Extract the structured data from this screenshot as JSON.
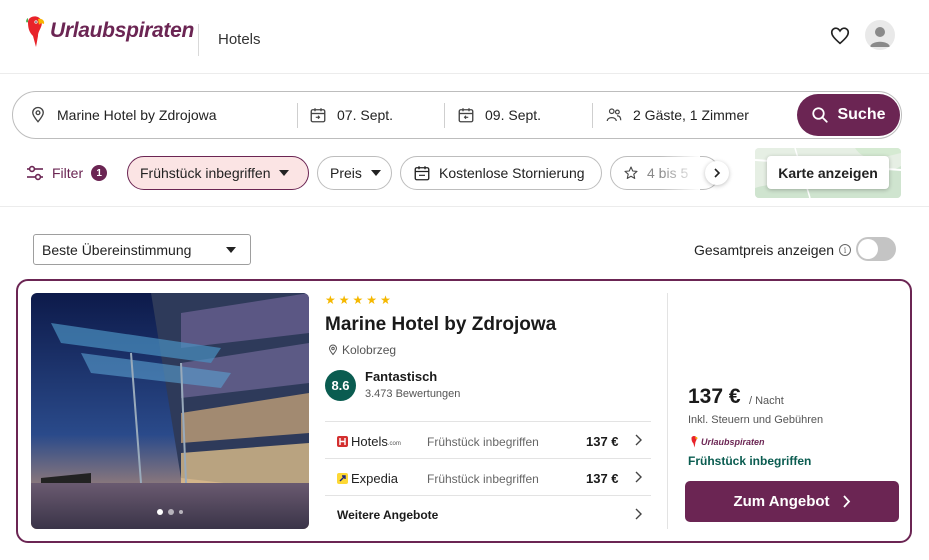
{
  "header": {
    "brand": "Urlaubspiraten",
    "section_label": "Hotels",
    "favorites_icon": "heart-icon",
    "profile_icon": "user-avatar-icon"
  },
  "search": {
    "destination": "Marine Hotel by Zdrojowa",
    "checkin": "07. Sept.",
    "checkout": "09. Sept.",
    "guests": "2 Gäste, 1 Zimmer",
    "button_label": "Suche"
  },
  "filters": {
    "filter_label": "Filter",
    "filter_count": "1",
    "chips": [
      {
        "label": "Frühstück inbegriffen",
        "active": true
      },
      {
        "label": "Preis",
        "active": false
      },
      {
        "label": "Kostenlose Stornierung",
        "active": false
      },
      {
        "label": "4 bis 5",
        "active": false
      }
    ],
    "map_button": "Karte anzeigen"
  },
  "sort": {
    "selected": "Beste Übereinstimmung",
    "total_price_label": "Gesamtpreis anzeigen",
    "total_price_on": false
  },
  "hotel": {
    "stars": 5,
    "name": "Marine Hotel by Zdrojowa",
    "location": "Kolobrzeg",
    "rating": "8.6",
    "rating_word": "Fantastisch",
    "reviews": "3.473 Bewertungen",
    "photo_index": "1 of 3",
    "offers": [
      {
        "provider": "Hotels",
        "provider_suffix": ".com",
        "description": "Frühstück inbegriffen",
        "price": "137 €"
      },
      {
        "provider": "Expedia",
        "description": "Frühstück inbegriffen",
        "price": "137 €"
      }
    ],
    "more_offers": "Weitere Angebote",
    "best_price": "137 €",
    "per_night": "/ Nacht",
    "taxes_note": "Inkl. Steuern und Gebühren",
    "best_provider": "Urlaubspiraten",
    "best_includes": "Frühstück inbegriffen",
    "cta": "Zum Angebot"
  },
  "colors": {
    "brand": "#6b2553",
    "active_chip_bg": "#fbe4e4",
    "rating_green": "#0a5c50",
    "star": "#f5b800"
  }
}
